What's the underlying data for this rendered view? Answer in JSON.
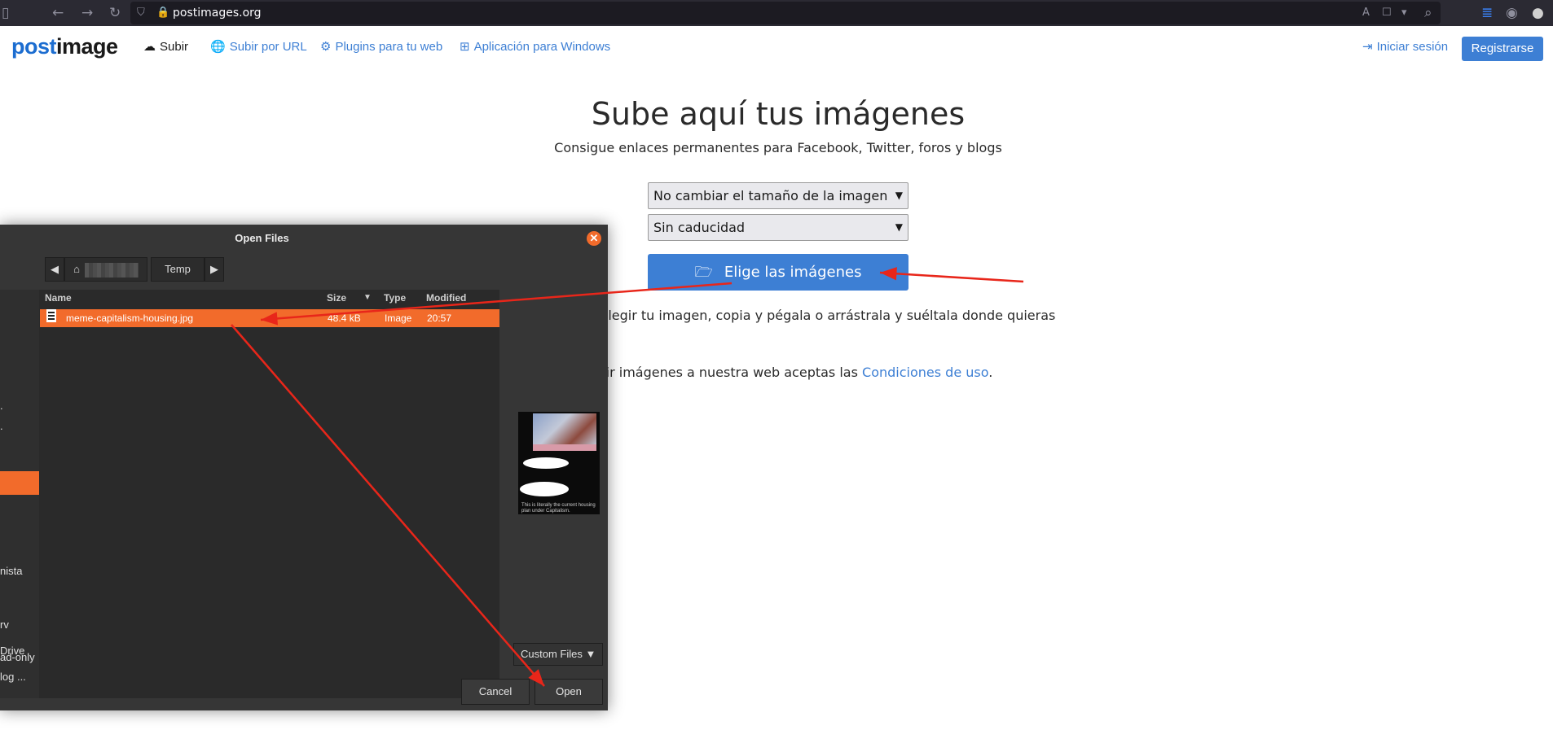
{
  "browser": {
    "url": "postimages.org",
    "icons": [
      "sidebar-icon",
      "back-icon",
      "forward-icon",
      "reload-icon",
      "shield-icon",
      "lock-icon",
      "translate-icon",
      "bookmark-icon",
      "dropdown-icon",
      "search-icon",
      "library-icon",
      "extension-icon",
      "account-icon"
    ]
  },
  "site": {
    "logo_a": "post",
    "logo_b": "image",
    "nav": [
      {
        "icon": "☁",
        "label": "Subir"
      },
      {
        "icon": "🌐",
        "label": "Subir por URL"
      },
      {
        "icon": "⚙",
        "label": "Plugins para tu web"
      },
      {
        "icon": "⊞",
        "label": "Aplicación para Windows"
      }
    ],
    "login": "Iniciar sesión",
    "register": "Registrarse"
  },
  "main": {
    "title": "Sube aquí tus imágenes",
    "subtitle": "Consigue enlaces permanentes para Facebook, Twitter, foros y blogs",
    "resize_select": "No cambiar el tamaño de la imagen",
    "expiry_select": "Sin caducidad",
    "choose_button": "Elige las imágenes",
    "hint_partial": "ra elegir tu imagen, copia y pégala o arrástrala y suéltala donde quieras",
    "terms_partial": "subir imágenes a nuestra web aceptas las ",
    "terms_link": "Condiciones de uso",
    "terms_end": "."
  },
  "dialog": {
    "title": "Open Files",
    "crumb_current": "Temp",
    "columns": {
      "name": "Name",
      "size": "Size",
      "type": "Type",
      "modified": "Modified"
    },
    "files": [
      {
        "name": "meme-capitalism-housing.jpg",
        "size": "48.4 kB",
        "type": "Image",
        "modified": "20:57"
      }
    ],
    "sidebar_partial": [
      "nista",
      "rv",
      "Drive",
      "log ..."
    ],
    "read_only_partial": "ad-only",
    "filter": "Custom Files",
    "cancel": "Cancel",
    "open": "Open",
    "preview_caption": "This is literally the current housing plan under Capitalism."
  },
  "annotation_color": "#e8261a"
}
